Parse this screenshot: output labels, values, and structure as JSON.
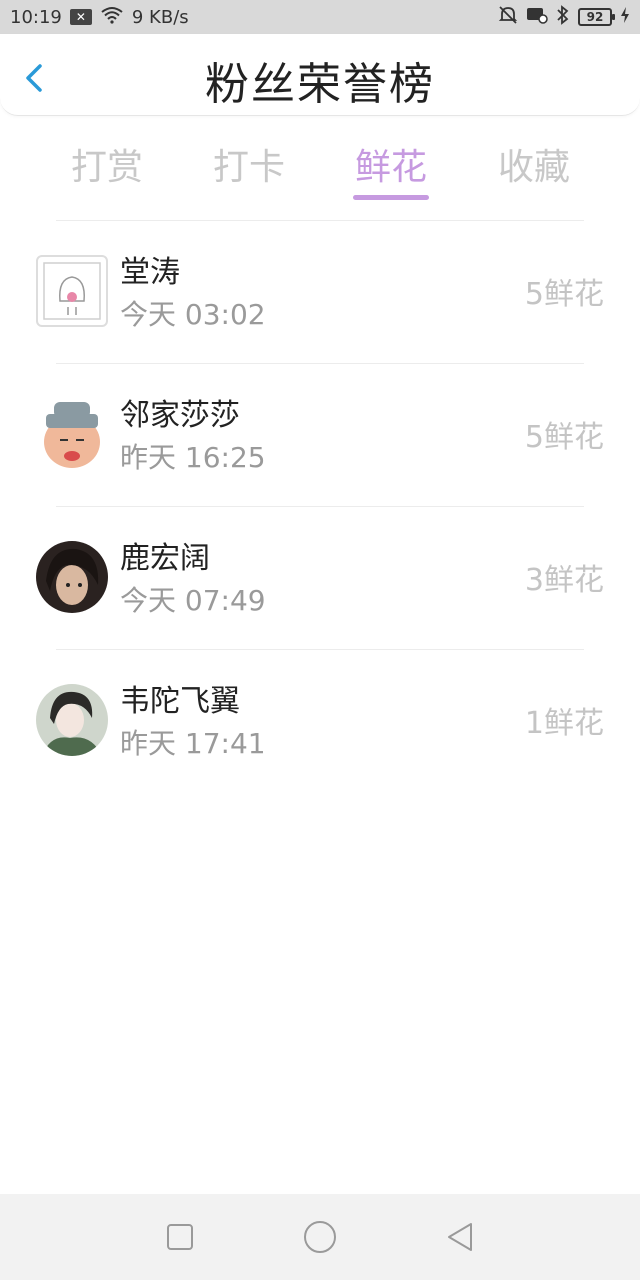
{
  "status_bar": {
    "time": "10:19",
    "notification_icon": "x-box-icon",
    "speed": "9 KB/s",
    "battery": "92"
  },
  "header": {
    "title": "粉丝荣誉榜",
    "back_icon": "chevron-left-icon"
  },
  "tabs": [
    {
      "label": "打赏",
      "active": false
    },
    {
      "label": "打卡",
      "active": false
    },
    {
      "label": "鲜花",
      "active": true
    },
    {
      "label": "收藏",
      "active": false
    }
  ],
  "colors": {
    "accent": "#c69ae0",
    "back_icon": "#2a9ad8"
  },
  "fans": [
    {
      "name": "堂涛",
      "time": "今天 03:02",
      "count": "5鲜花"
    },
    {
      "name": "邻家莎莎",
      "time": "昨天 16:25",
      "count": "5鲜花"
    },
    {
      "name": "鹿宏阔",
      "time": "今天 07:49",
      "count": "3鲜花"
    },
    {
      "name": "韦陀飞翼",
      "time": "昨天 17:41",
      "count": "1鲜花"
    }
  ],
  "nav": {
    "recent": "square-icon",
    "home": "circle-icon",
    "back": "triangle-back-icon"
  }
}
